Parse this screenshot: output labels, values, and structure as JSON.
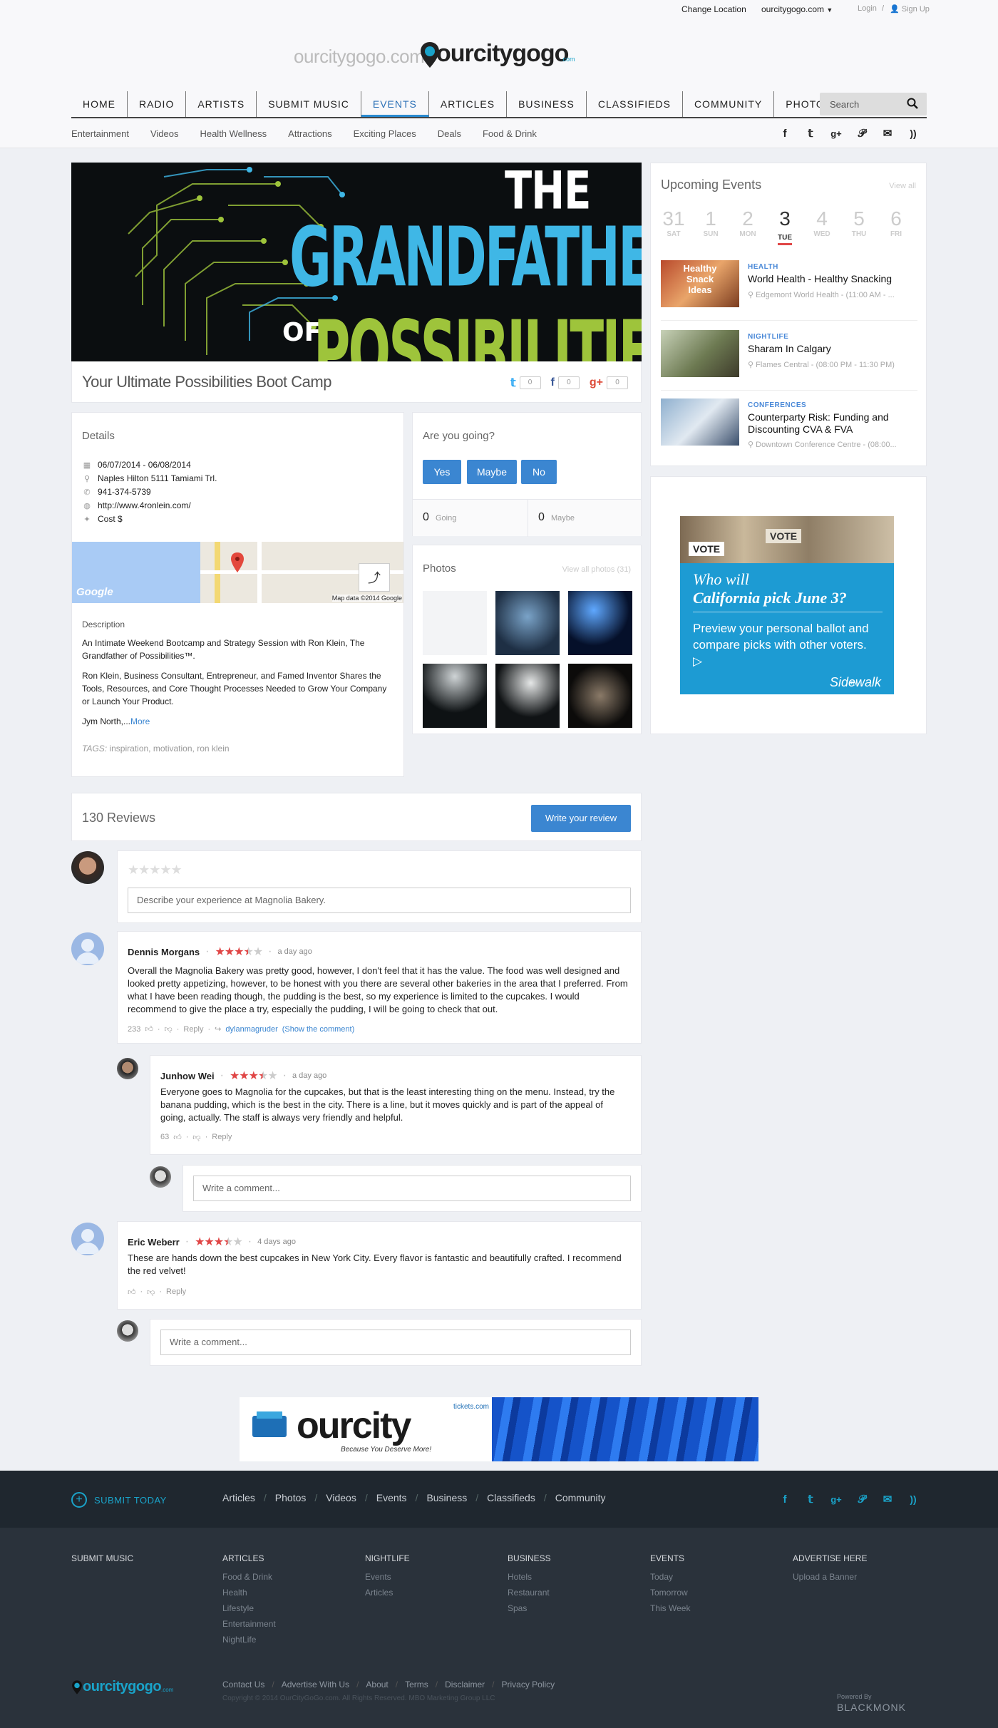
{
  "header": {
    "change_location": "Change Location",
    "location_select": "ourcitygogo.com",
    "login": "Login",
    "signup": "Sign Up",
    "logo_prefix": "ourcitygogo.com",
    "logo_main": "ourcitygogo",
    "logo_suffix": ".com",
    "nav": [
      "HOME",
      "RADIO",
      "ARTISTS",
      "SUBMIT MUSIC",
      "EVENTS",
      "ARTICLES",
      "BUSINESS",
      "CLASSIFIEDS",
      "COMMUNITY",
      "PHOTOS"
    ],
    "active_nav": "EVENTS",
    "search_placeholder": "Search",
    "subnav": [
      "Entertainment",
      "Videos",
      "Health Wellness",
      "Attractions",
      "Exciting Places",
      "Deals",
      "Food & Drink"
    ],
    "social_icons": [
      "facebook-icon",
      "twitter-icon",
      "google-plus-icon",
      "pinterest-icon",
      "mail-icon",
      "rss-icon"
    ]
  },
  "event": {
    "hero_the": "THE",
    "hero_grandfather": "GRANDFATHER",
    "hero_of": "OF",
    "hero_possibilities": "POSSIBILITIES",
    "title": "Your Ultimate Possibilities Boot Camp",
    "shares": {
      "twitter": "0",
      "facebook": "0",
      "gplus": "0"
    }
  },
  "details": {
    "heading": "Details",
    "dates": "06/07/2014 - 06/08/2014",
    "address": "Naples Hilton 5111 Tamiami Trl.",
    "phone": "941-374-5739",
    "website": "http://www.4ronlein.com/",
    "cost": "Cost $",
    "map_credit": "Map data ©2014 Google",
    "map_google": "Google",
    "description_heading": "Description",
    "desc_p1": "An Intimate Weekend Bootcamp and Strategy Session with Ron Klein, The Grandfather of Possibilities™.",
    "desc_p2": "Ron Klein, Business Consultant, Entrepreneur, and Famed Inventor Shares the Tools, Resources, and Core Thought Processes Needed to Grow Your Company or Launch Your Product.",
    "desc_p3": "Jym North,...",
    "more": "More",
    "tags_label": "TAGS:",
    "tags": "inspiration, motivation, ron klein"
  },
  "rsvp": {
    "heading": "Are you going?",
    "yes": "Yes",
    "maybe": "Maybe",
    "no": "No",
    "going_count": "0",
    "going_label": "Going",
    "maybe_count": "0",
    "maybe_label": "Maybe"
  },
  "photos": {
    "heading": "Photos",
    "view_all": "View all photos (31)"
  },
  "upcoming": {
    "heading": "Upcoming Events",
    "view_all": "View all",
    "days": [
      {
        "n": "31",
        "w": "SAT"
      },
      {
        "n": "1",
        "w": "SUN"
      },
      {
        "n": "2",
        "w": "MON"
      },
      {
        "n": "3",
        "w": "TUE"
      },
      {
        "n": "4",
        "w": "WED"
      },
      {
        "n": "5",
        "w": "THU"
      },
      {
        "n": "6",
        "w": "FRI"
      }
    ],
    "selected_day": "3",
    "events": [
      {
        "cat": "HEALTH",
        "title": "World Health - Healthy Snacking",
        "loc": "Edgemont World Health - (11:00 AM - ...",
        "thumb": "Healthy Snack Ideas"
      },
      {
        "cat": "NIGHTLIFE",
        "title": "Sharam In Calgary",
        "loc": "Flames Central - (08:00 PM - 11:30 PM)"
      },
      {
        "cat": "CONFERENCES",
        "title": "Counterparty Risk: Funding and Discounting CVA & FVA",
        "loc": "Downtown Conference Centre - (08:00..."
      }
    ]
  },
  "ad": {
    "vote": "VOTE",
    "headline1": "Who will",
    "headline2": "California pick June 3?",
    "body": "Preview your personal ballot and compare picks with other voters.",
    "brand_my": "my",
    "brand": "Sidewalk"
  },
  "reviews": {
    "heading": "130 Reviews",
    "write_button": "Write your review",
    "compose_placeholder": "Describe your experience at Magnolia Bakery.",
    "items": [
      {
        "name": "Dennis Morgans",
        "time": "a day ago",
        "rating": 3.5,
        "text": "Overall the Magnolia Bakery was pretty good, however, I don't feel that it has the value. The food was well designed and looked pretty appetizing, however, to be honest with you there are several other bakeries in the area that I preferred. From what I have been reading though, the pudding is the best, so my experience is limited to the cupcakes. I would recommend to give the place a try, especially the pudding, I will be going to check that out.",
        "likes": "233",
        "reply": "Reply",
        "replied_by": "dylanmagruder",
        "show_comment": "(Show the comment)"
      },
      {
        "name": "Junhow Wei",
        "time": "a day ago",
        "rating": 3.5,
        "text": "Everyone goes to Magnolia for the cupcakes, but that is the least interesting thing on the menu. Instead, try the banana pudding, which is the best in the city. There is a line, but it moves quickly and is part of the appeal of going, actually. The staff is always very friendly and helpful.",
        "likes": "63",
        "reply": "Reply"
      },
      {
        "name": "Eric Weberr",
        "time": "4 days ago",
        "rating": 3.5,
        "text": "These are hands down the best cupcakes in New York City. Every flavor is fantastic and beautifully crafted. I recommend the red velvet!",
        "likes": "",
        "reply": "Reply"
      }
    ],
    "comment_placeholder": "Write a comment..."
  },
  "banner": {
    "brand": "ourcity",
    "domain": "tickets.com",
    "tagline": "Because You Deserve More!"
  },
  "footer": {
    "submit_today": "SUBMIT TODAY",
    "nav": [
      "Articles",
      "Photos",
      "Videos",
      "Events",
      "Business",
      "Classifieds",
      "Community"
    ],
    "cols": [
      {
        "h": "SUBMIT MUSIC",
        "items": []
      },
      {
        "h": "ARTICLES",
        "items": [
          "Food & Drink",
          "Health",
          "Lifestyle",
          "Entertainment",
          "NightLife"
        ]
      },
      {
        "h": "NIGHTLIFE",
        "items": [
          "Events",
          "Articles"
        ]
      },
      {
        "h": "BUSINESS",
        "items": [
          "Hotels",
          "Restaurant",
          "Spas"
        ]
      },
      {
        "h": "EVENTS",
        "items": [
          "Today",
          "Tomorrow",
          "This Week"
        ]
      },
      {
        "h": "ADVERTISE HERE",
        "items": [
          "Upload a Banner"
        ]
      }
    ],
    "bottom_links": [
      "Contact Us",
      "Advertise With Us",
      "About",
      "Terms",
      "Disclaimer",
      "Privacy Policy"
    ],
    "copyright": "Copyright © 2014 OurCityGoGo.com. All Rights Reserved. MBO Marketing Group LLC",
    "logo": "ourcitygogo",
    "logo_suffix": ".com",
    "powered_by": "Powered By",
    "powered_brand": "BLACKMONK"
  },
  "colors": {
    "accent": "#3b86d1",
    "brand_teal": "#1aa3c9",
    "star": "#e04646",
    "footer_dark": "#1f272f",
    "footer": "#2a323b"
  }
}
